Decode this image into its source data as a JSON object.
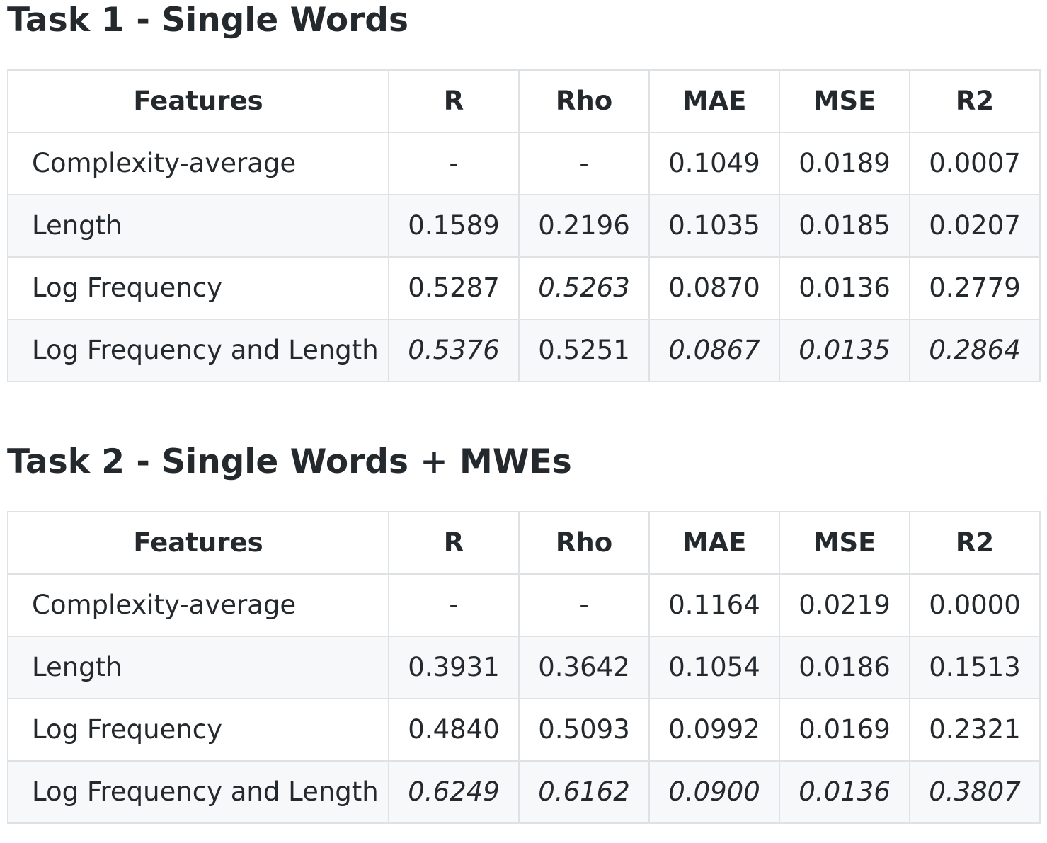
{
  "columns": [
    "Features",
    "R",
    "Rho",
    "MAE",
    "MSE",
    "R2"
  ],
  "sections": [
    {
      "heading": "Task 1 - Single Words",
      "rows": [
        {
          "feature": "Complexity-average",
          "values": [
            "-",
            "-",
            "0.1049",
            "0.0189",
            "0.0007"
          ],
          "italic": [
            false,
            false,
            false,
            false,
            false
          ]
        },
        {
          "feature": "Length",
          "values": [
            "0.1589",
            "0.2196",
            "0.1035",
            "0.0185",
            "0.0207"
          ],
          "italic": [
            false,
            false,
            false,
            false,
            false
          ]
        },
        {
          "feature": "Log Frequency",
          "values": [
            "0.5287",
            "0.5263",
            "0.0870",
            "0.0136",
            "0.2779"
          ],
          "italic": [
            false,
            true,
            false,
            false,
            false
          ]
        },
        {
          "feature": "Log Frequency and Length",
          "values": [
            "0.5376",
            "0.5251",
            "0.0867",
            "0.0135",
            "0.2864"
          ],
          "italic": [
            true,
            false,
            true,
            true,
            true
          ]
        }
      ]
    },
    {
      "heading": "Task 2 - Single Words + MWEs",
      "rows": [
        {
          "feature": "Complexity-average",
          "values": [
            "-",
            "-",
            "0.1164",
            "0.0219",
            "0.0000"
          ],
          "italic": [
            false,
            false,
            false,
            false,
            false
          ]
        },
        {
          "feature": "Length",
          "values": [
            "0.3931",
            "0.3642",
            "0.1054",
            "0.0186",
            "0.1513"
          ],
          "italic": [
            false,
            false,
            false,
            false,
            false
          ]
        },
        {
          "feature": "Log Frequency",
          "values": [
            "0.4840",
            "0.5093",
            "0.0992",
            "0.0169",
            "0.2321"
          ],
          "italic": [
            false,
            false,
            false,
            false,
            false
          ]
        },
        {
          "feature": "Log Frequency and Length",
          "values": [
            "0.6249",
            "0.6162",
            "0.0900",
            "0.0136",
            "0.3807"
          ],
          "italic": [
            true,
            true,
            true,
            true,
            true
          ]
        }
      ]
    }
  ]
}
